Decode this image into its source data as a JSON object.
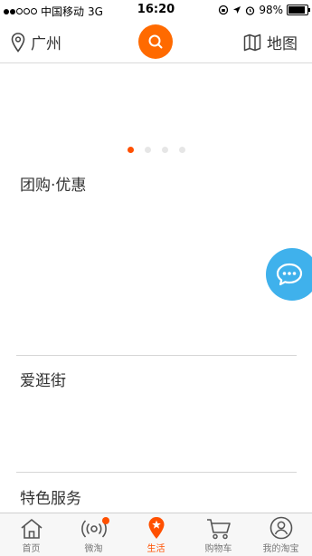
{
  "status_bar": {
    "carrier": "中国移动",
    "network": "3G",
    "time": "16:20",
    "battery": "98%",
    "battery_level": 0.98
  },
  "nav": {
    "city": "广州",
    "map_label": "地图",
    "accent": "#ff6a00"
  },
  "carousel": {
    "page_count": 4,
    "active_index": 0
  },
  "sections": {
    "group_buy": "团购·优惠",
    "shopping_street": "爱逛街",
    "special_services": "特色服务"
  },
  "tabs": [
    {
      "label": "首页",
      "icon": "home-icon",
      "active": false
    },
    {
      "label": "微淘",
      "icon": "broadcast-icon",
      "active": false,
      "badge": true
    },
    {
      "label": "生活",
      "icon": "location-star-icon",
      "active": true
    },
    {
      "label": "购物车",
      "icon": "cart-icon",
      "active": false
    },
    {
      "label": "我的淘宝",
      "icon": "profile-icon",
      "active": false
    }
  ],
  "colors": {
    "active": "#ff5000",
    "chat": "#3fb1ec"
  }
}
